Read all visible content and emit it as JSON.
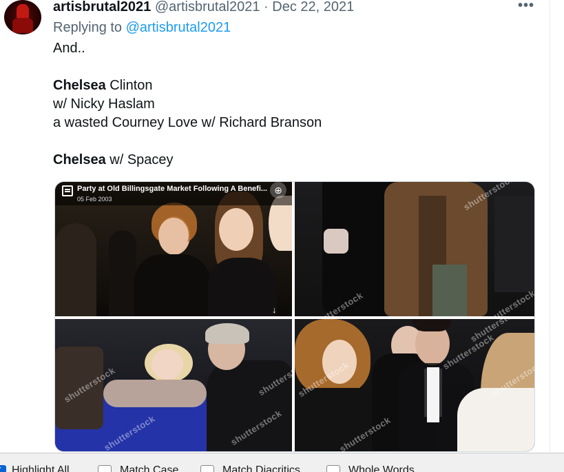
{
  "tweet": {
    "author_name": "artisbrutal2021",
    "author_handle": "@artisbrutal2021",
    "separator": "·",
    "date": "Dec 22, 2021",
    "more_label": "•••",
    "replying_prefix": "Replying to ",
    "replying_handle": "@artisbrutal2021",
    "lines": [
      {
        "bold": "",
        "text": "And.."
      },
      {
        "bold": "",
        "text": ""
      },
      {
        "bold": "Chelsea",
        "text": " Clinton"
      },
      {
        "bold": "",
        "text": "w/ Nicky Haslam"
      },
      {
        "bold": "",
        "text": "a wasted Courney Love w/ Richard Branson"
      },
      {
        "bold": "",
        "text": ""
      },
      {
        "bold": "Chelsea",
        "text": " w/ Spacey"
      }
    ]
  },
  "media": {
    "image1": {
      "caption_title": "Party at Old Billingsgate Market Following A Benefi...",
      "caption_date": "05 Feb 2003",
      "zoom_icon": "⊕",
      "download_icon": "↓"
    },
    "watermark": "shutterstock"
  },
  "findbar": {
    "highlight_all": {
      "label": "Highlight All",
      "checked": true
    },
    "match_case": {
      "label": "Match Case",
      "checked": false
    },
    "match_diacritics": {
      "label": "Match Diacritics",
      "checked": false
    },
    "whole_words": {
      "label": "Whole Words",
      "checked": false
    }
  },
  "colors": {
    "link": "#1d9bf0",
    "secondary_text": "#536471",
    "primary_text": "#0f1419",
    "checkbox_checked": "#0a64d6"
  }
}
